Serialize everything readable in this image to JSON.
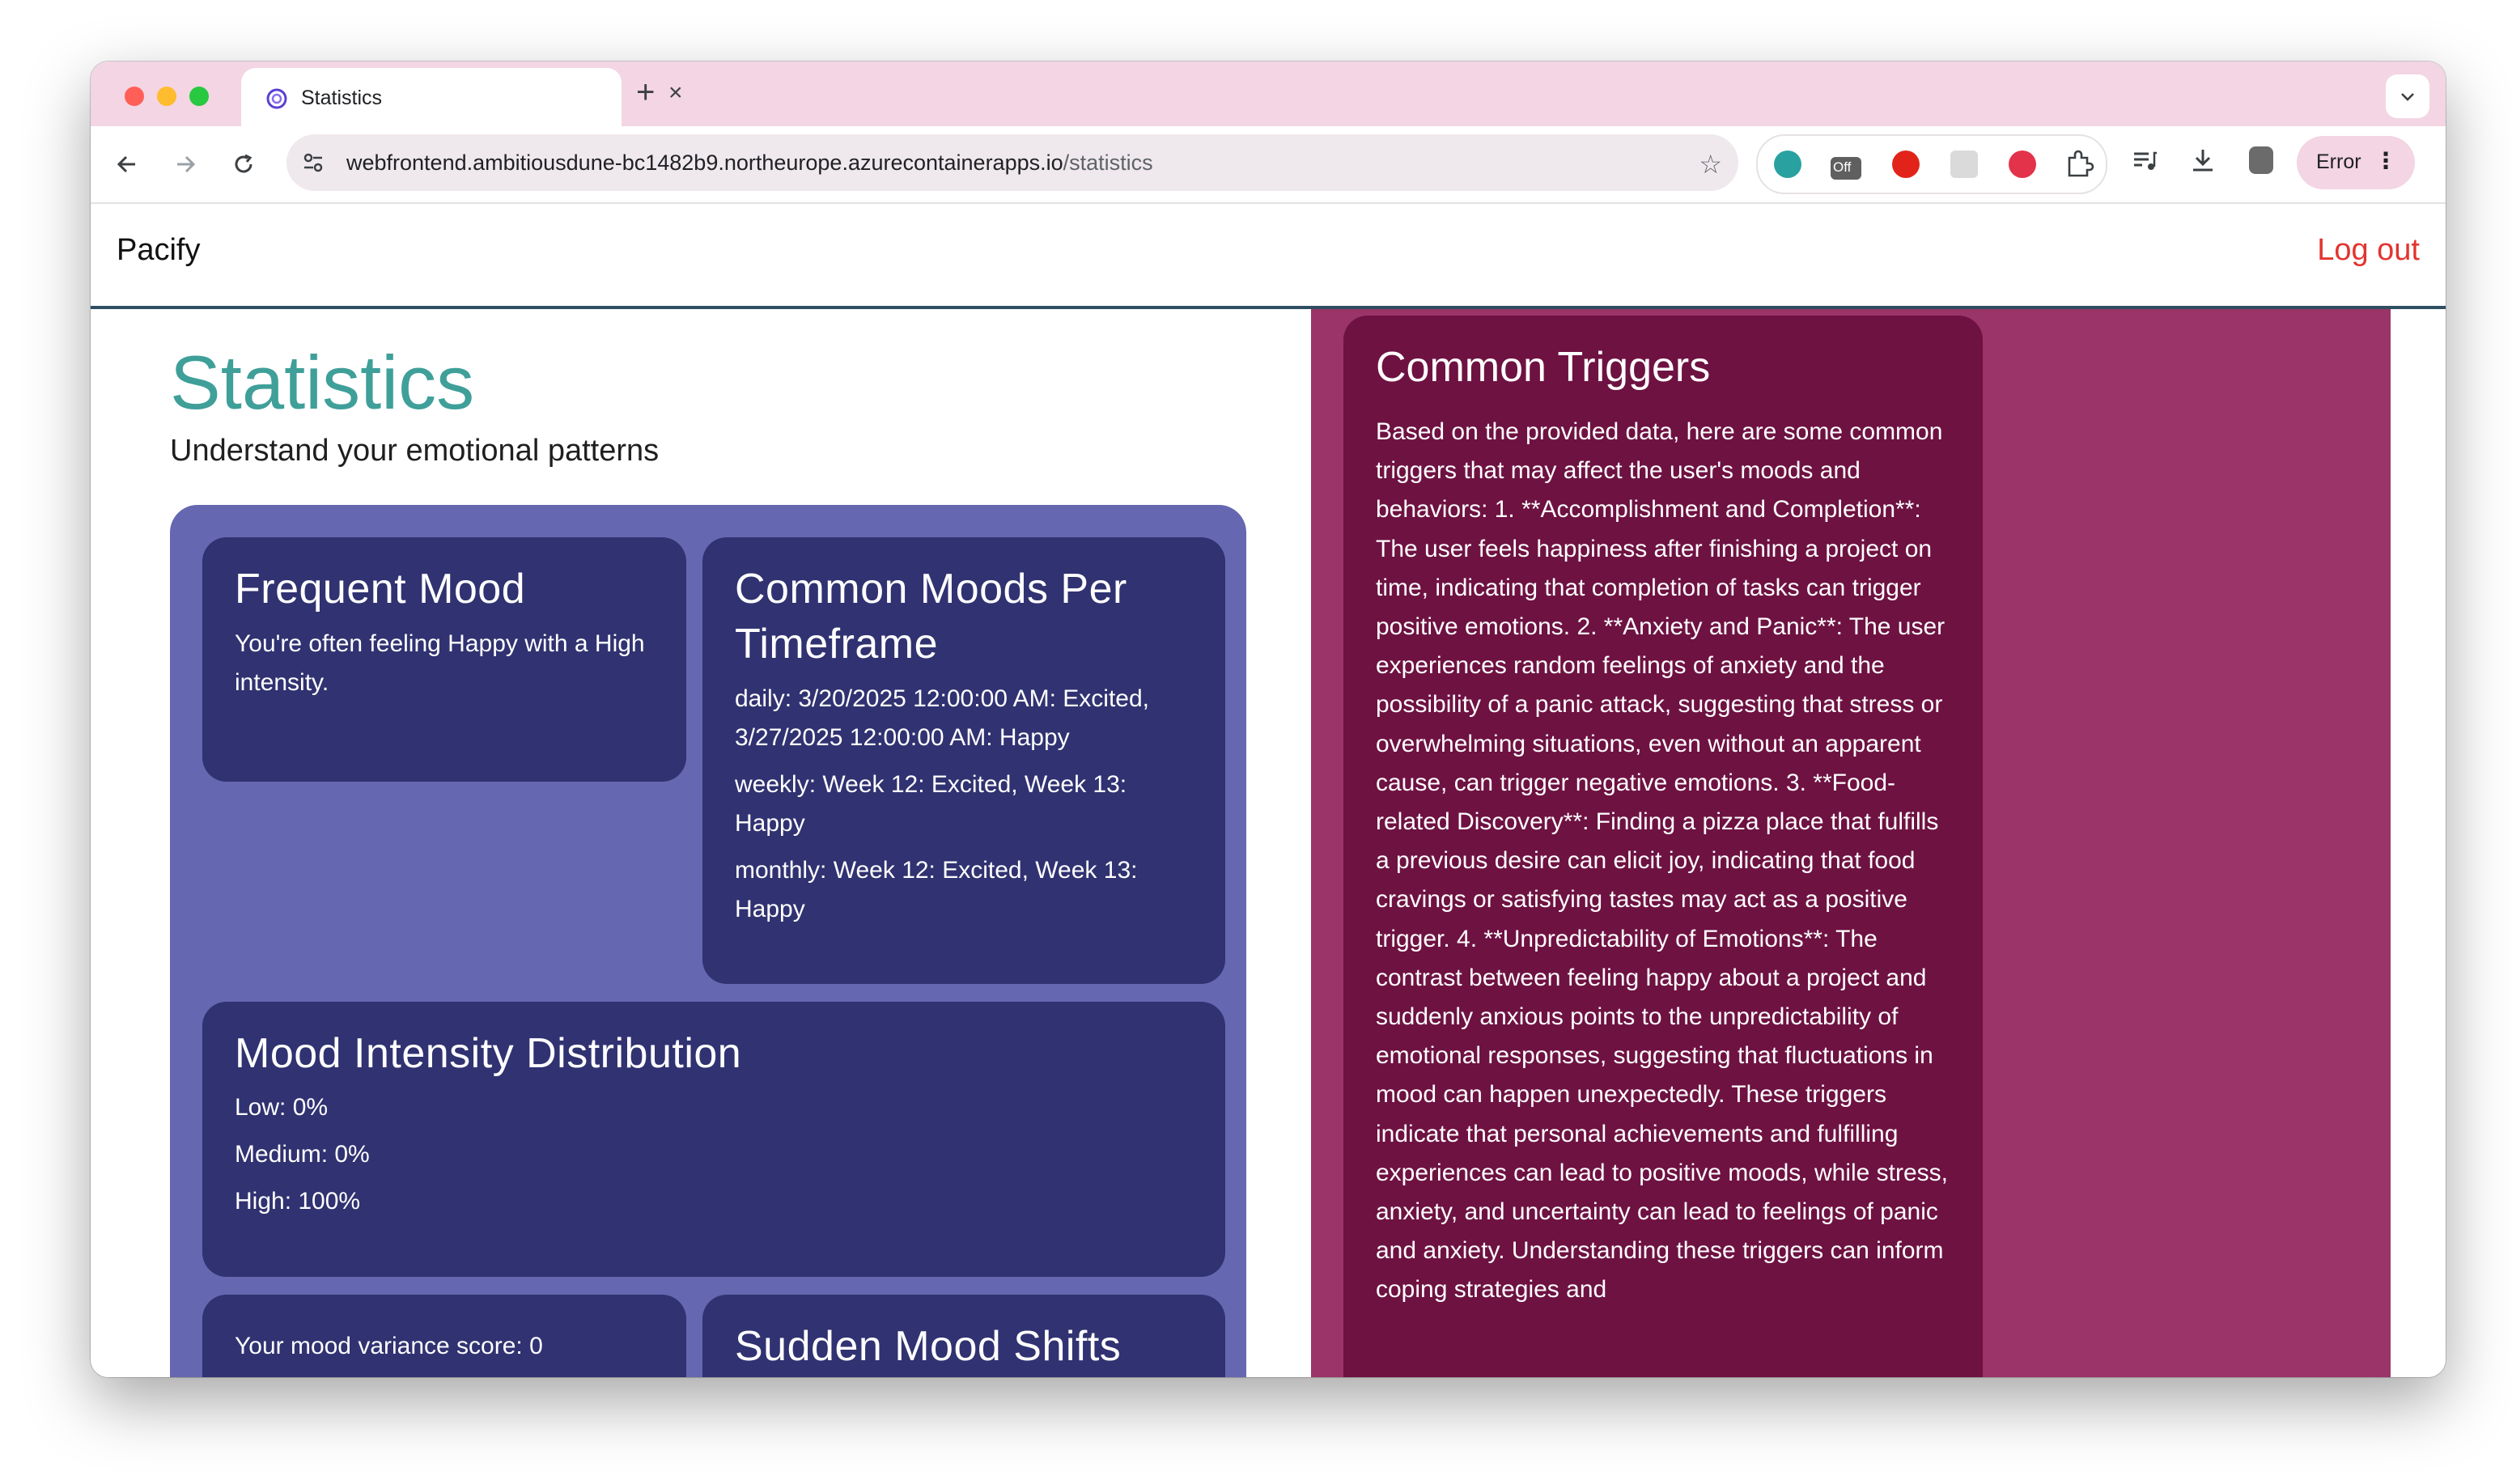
{
  "browser": {
    "tab": {
      "title": "Statistics",
      "close_icon": "×"
    },
    "new_tab_icon": "+",
    "url": {
      "host": "webfrontend.ambitiousdune-bc1482b9.northeurope.azurecontainerapps.io",
      "path": "/statistics"
    },
    "extensions": {
      "off_badge": "Off"
    },
    "profile_status": "Error",
    "kebab": "⋮"
  },
  "app": {
    "brand": "Pacify",
    "logout_label": "Log out"
  },
  "statistics": {
    "title": "Statistics",
    "subtitle": "Understand your emotional patterns",
    "frequent_mood": {
      "title": "Frequent Mood",
      "text": "You're often feeling Happy with a High intensity."
    },
    "common_moods": {
      "title": "Common Moods Per Timeframe",
      "daily": "daily: 3/20/2025 12:00:00 AM: Excited, 3/27/2025 12:00:00 AM: Happy",
      "weekly": "weekly: Week 12: Excited, Week 13: Happy",
      "monthly": "monthly: Week 12: Excited, Week 13: Happy"
    },
    "intensity": {
      "title": "Mood Intensity Distribution",
      "low": "Low: 0%",
      "medium": "Medium: 0%",
      "high": "High: 100%"
    },
    "variance": {
      "text": "Your mood variance score: 0"
    },
    "sudden_shifts": {
      "title": "Sudden Mood Shifts"
    }
  },
  "triggers": {
    "title": "Common Triggers",
    "text": "Based on the provided data, here are some common triggers that may affect the user's moods and behaviors: 1. **Accomplishment and Completion**: The user feels happiness after finishing a project on time, indicating that completion of tasks can trigger positive emotions. 2. **Anxiety and Panic**: The user experiences random feelings of anxiety and the possibility of a panic attack, suggesting that stress or overwhelming situations, even without an apparent cause, can trigger negative emotions. 3. **Food-related Discovery**: Finding a pizza place that fulfills a previous desire can elicit joy, indicating that food cravings or satisfying tastes may act as a positive trigger. 4. **Unpredictability of Emotions**: The contrast between feeling happy about a project and suddenly anxious points to the unpredictability of emotional responses, suggesting that fluctuations in mood can happen unexpectedly. These triggers indicate that personal achievements and fulfilling experiences can lead to positive moods, while stress, anxiety, and uncertainty can lead to feelings of panic and anxiety. Understanding these triggers can inform coping strategies and"
  },
  "colors": {
    "accent_title": "#3f9f99",
    "panel": "#6567b0",
    "card": "#303271",
    "right_column": "#9b3468",
    "trigger_card": "#6e1242",
    "logout": "#e3342f",
    "tabstrip": "#f3d5e3"
  }
}
